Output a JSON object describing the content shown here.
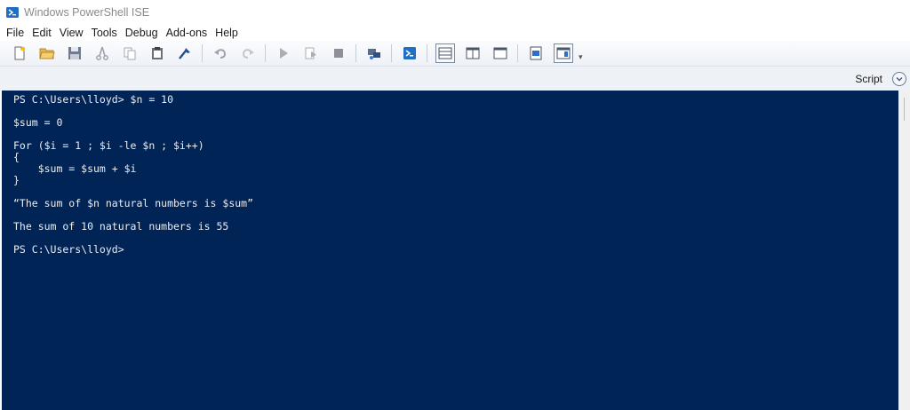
{
  "window": {
    "title": "Windows PowerShell ISE"
  },
  "menu": [
    "File",
    "Edit",
    "View",
    "Tools",
    "Debug",
    "Add-ons",
    "Help"
  ],
  "toolbar": {
    "icons": [
      "new-file-icon",
      "open-file-icon",
      "save-icon",
      "cut-icon",
      "copy-icon",
      "paste-icon",
      "clear-console-icon",
      "undo-icon",
      "redo-icon",
      "run-script-icon",
      "run-selection-icon",
      "stop-icon",
      "remote-tab-icon",
      "powershell-console-icon",
      "layout-script-top-icon",
      "layout-script-right-icon",
      "layout-script-maximized-icon",
      "show-command-window-icon",
      "show-command-addon-icon"
    ]
  },
  "scriptbar": {
    "label": "Script"
  },
  "console": {
    "lines": [
      "PS C:\\Users\\lloyd> $n = 10",
      "",
      "$sum = 0",
      "",
      "For ($i = 1 ; $i -le $n ; $i++)",
      "{",
      "    $sum = $sum + $i",
      "}",
      "",
      "“The sum of $n natural numbers is $sum”",
      "",
      "The sum of 10 natural numbers is 55",
      "",
      "PS C:\\Users\\lloyd>"
    ]
  },
  "colors": {
    "console_bg": "#012456",
    "console_text": "#eeedf0",
    "toolbar_bg": "#eef1f6"
  }
}
